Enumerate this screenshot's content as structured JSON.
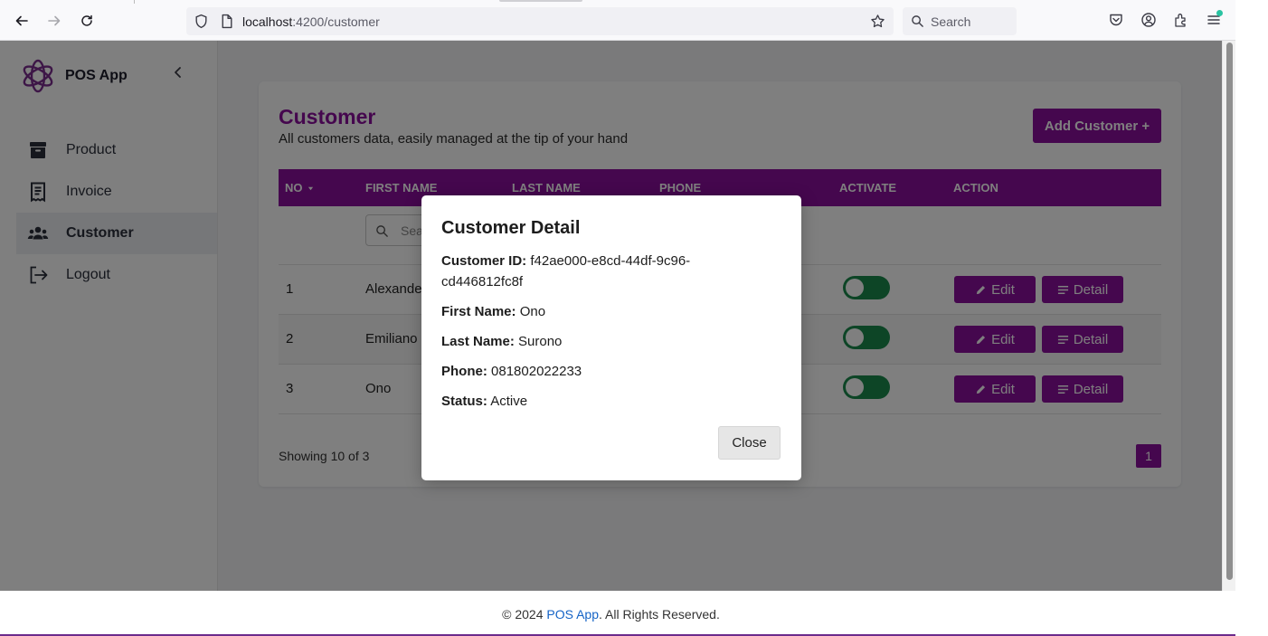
{
  "browser": {
    "url_host": "localhost",
    "url_path": ":4200/customer",
    "search_placeholder": "Search"
  },
  "app": {
    "name": "POS App"
  },
  "sidebar": {
    "items": [
      {
        "label": "Product",
        "icon": "archive-icon"
      },
      {
        "label": "Invoice",
        "icon": "receipt-icon"
      },
      {
        "label": "Customer",
        "icon": "users-icon",
        "active": true
      },
      {
        "label": "Logout",
        "icon": "logout-icon"
      }
    ]
  },
  "page": {
    "title": "Customer",
    "subtitle": "All customers data, easily managed at the tip of your hand",
    "add_button": "Add Customer +"
  },
  "table": {
    "columns": [
      "NO",
      "FIRST NAME",
      "LAST NAME",
      "PHONE",
      "ACTIVATE",
      "ACTION"
    ],
    "search_placeholder": "Sea",
    "rows": [
      {
        "no": "1",
        "first_name": "Alexande",
        "active": true
      },
      {
        "no": "2",
        "first_name": "Emiliano",
        "active": true
      },
      {
        "no": "3",
        "first_name": "Ono",
        "active": true
      }
    ],
    "edit_label": "Edit",
    "detail_label": "Detail",
    "showing_text": "Showing 10 of 3",
    "current_page": "1"
  },
  "modal": {
    "title": "Customer Detail",
    "fields": [
      {
        "label": "Customer ID:",
        "value": "f42ae000-e8cd-44df-9c96-cd446812fc8f"
      },
      {
        "label": "First Name:",
        "value": "Ono"
      },
      {
        "label": "Last Name:",
        "value": "Surono"
      },
      {
        "label": "Phone:",
        "value": "081802022233"
      },
      {
        "label": "Status:",
        "value": "Active"
      }
    ],
    "close_label": "Close"
  },
  "footer": {
    "prefix": "© 2024 ",
    "brand": "POS App",
    "suffix": ". All Rights Reserved."
  },
  "colors": {
    "accent": "#8a0f9c",
    "toggle_on": "#1a8a4d",
    "link": "#1463c6"
  }
}
